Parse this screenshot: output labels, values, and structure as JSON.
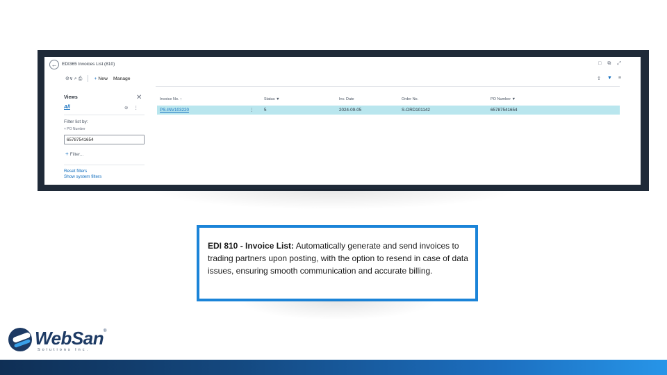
{
  "app": {
    "title": "EDI365 Invoices List (810)",
    "back_icon": "←",
    "window_icons": [
      "□",
      "⧉",
      "⤢"
    ]
  },
  "toolbar": {
    "search_icons": "⊘∨  ⌕  ⎙",
    "new_label": "New",
    "manage_label": "Manage",
    "right_icons": [
      "⇪",
      "▼",
      "≡"
    ]
  },
  "filter_pane": {
    "views_label": "Views",
    "close_icon": "✕",
    "all_label": "All",
    "view_icons": [
      "⊜",
      "⋮"
    ],
    "filter_list_by": "Filter list by:",
    "field_label": "× PO Number",
    "field_value": "65787541654",
    "add_filter_label": "Filter...",
    "reset_filters": "Reset filters",
    "show_system_filters": "Show system filters"
  },
  "table": {
    "headers": {
      "invoice_no": "Invoice No. ↑",
      "status": "Status ▼",
      "inv_date": "Inv. Date",
      "order_no": "Order No.",
      "po_number": "PO Number ▼"
    },
    "rows": [
      {
        "invoice_no": "PS-INV103220",
        "actions": "⋮",
        "status": "5",
        "inv_date": "2024-09-05",
        "order_no": "S-ORD101142",
        "po_number": "65787541654"
      }
    ]
  },
  "callout": {
    "bold": "EDI 810 - Invoice List:",
    "text": " Automatically generate and send invoices to trading partners upon posting, with the option to resend in case of data issues, ensuring smooth communication and accurate billing."
  },
  "logo": {
    "word": "WebSan",
    "reg": "®",
    "sub": "Solutions Inc."
  },
  "colors": {
    "frame": "#1f2a38",
    "accent": "#1b84d8",
    "row_highlight": "#b9e6ee",
    "link": "#0f6cbd",
    "brand": "#1d3a64"
  }
}
